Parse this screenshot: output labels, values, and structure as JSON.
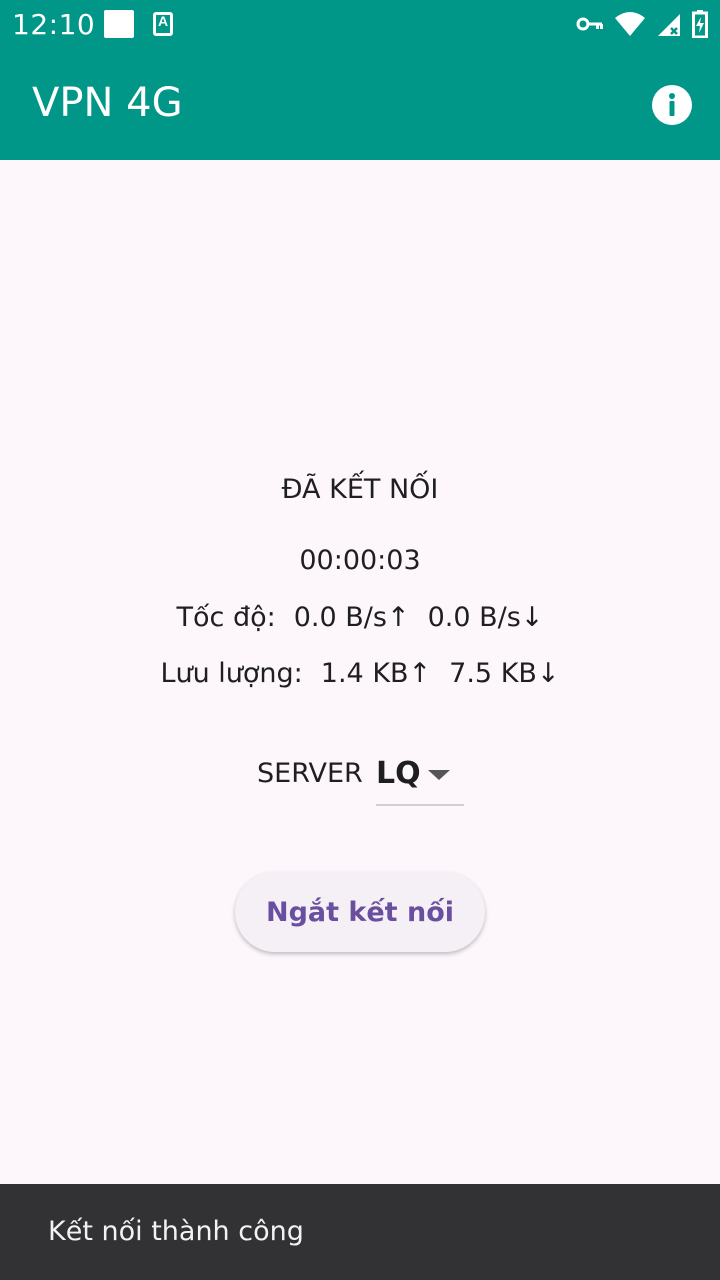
{
  "status_bar": {
    "time": "12:10",
    "icons": [
      "notification-square-icon",
      "accessibility-a-icon",
      "vpn-key-icon",
      "wifi-icon",
      "signal-icon",
      "battery-charging-icon"
    ],
    "a_icon_letter": "A"
  },
  "app_bar": {
    "title": "VPN 4G",
    "info_icon": "info-icon",
    "background": "#009688"
  },
  "connection": {
    "status": "ĐÃ KẾT NỐI",
    "timer": "00:00:03",
    "speed_label": "Tốc độ:",
    "speed_up": "0.0 B/s↑",
    "speed_down": "0.0 B/s↓",
    "traffic_label": "Lưu lượng:",
    "traffic_up": "1.4 KB↑",
    "traffic_down": "7.5 KB↓"
  },
  "server": {
    "label": "SERVER",
    "selected": "LQ"
  },
  "disconnect_button": {
    "label": "Ngắt kết nối",
    "color": "#6a4fa0"
  },
  "snackbar": {
    "message": "Kết nối thành công"
  }
}
